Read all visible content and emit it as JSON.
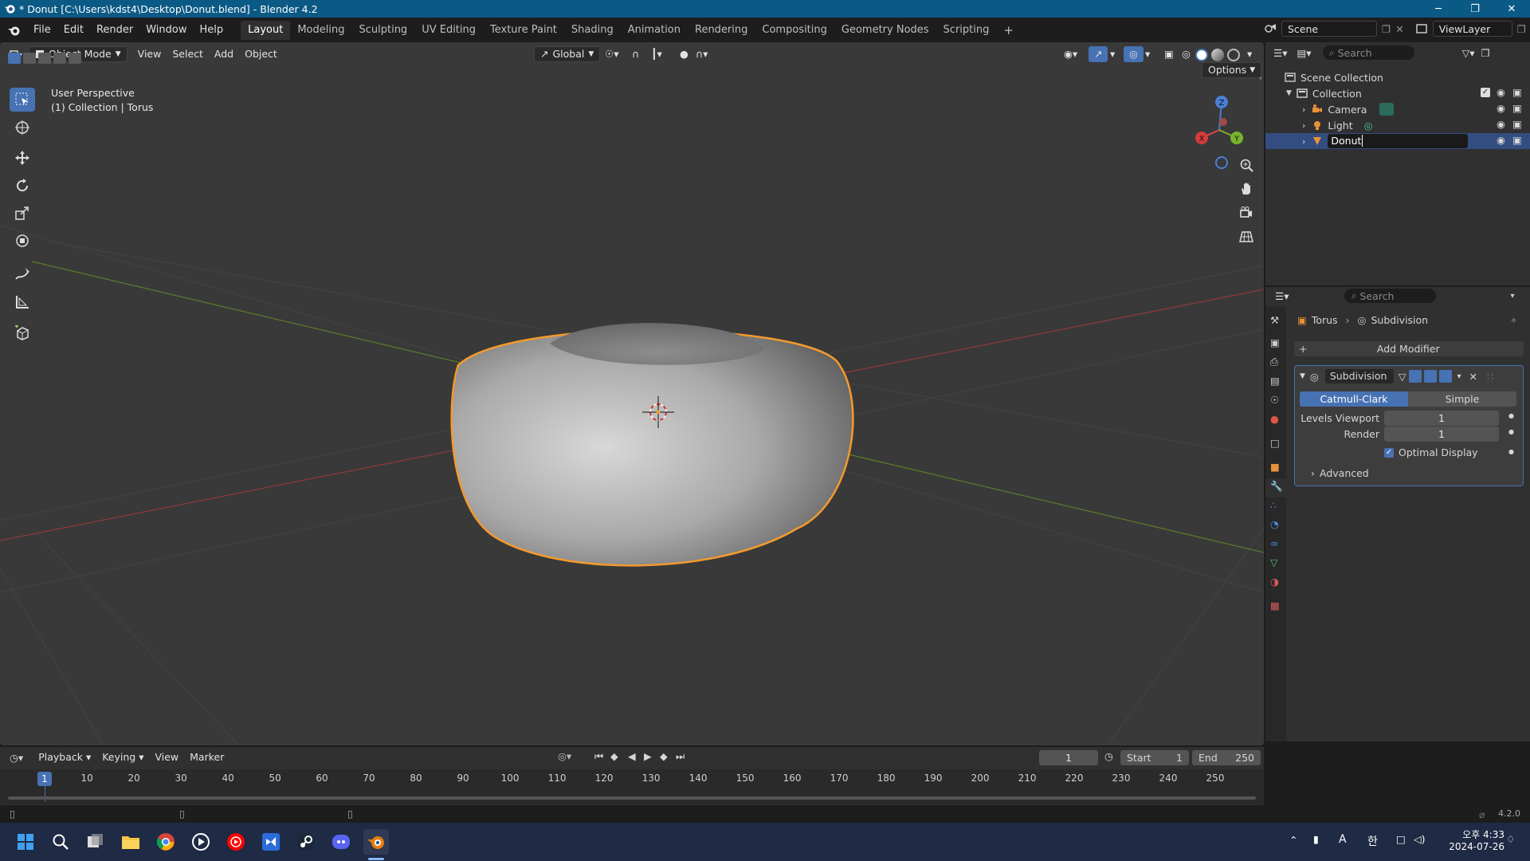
{
  "window": {
    "title": "* Donut [C:\\Users\\kdst4\\Desktop\\Donut.blend] - Blender 4.2"
  },
  "menu": [
    "File",
    "Edit",
    "Render",
    "Window",
    "Help"
  ],
  "workspaces": [
    "Layout",
    "Modeling",
    "Sculpting",
    "UV Editing",
    "Texture Paint",
    "Shading",
    "Animation",
    "Rendering",
    "Compositing",
    "Geometry Nodes",
    "Scripting"
  ],
  "active_workspace": "Layout",
  "scene": {
    "name": "Scene",
    "view_layer": "ViewLayer"
  },
  "viewport": {
    "mode": "Object Mode",
    "menus": [
      "View",
      "Select",
      "Add",
      "Object"
    ],
    "transform_orientation": "Global",
    "options_label": "Options",
    "perspective_label": "User Perspective",
    "context_label": "(1) Collection | Torus",
    "gizmo_axes": {
      "x": "X",
      "y": "Y",
      "z": "Z"
    }
  },
  "outliner": {
    "search_placeholder": "Search",
    "root": "Scene Collection",
    "collection": "Collection",
    "items": [
      "Camera",
      "Light"
    ],
    "editing_item": "Donut"
  },
  "properties": {
    "search_placeholder": "Search",
    "breadcrumb_object": "Torus",
    "breadcrumb_modifier": "Subdivision",
    "add_modifier": "Add Modifier",
    "modifier_name": "Subdivision",
    "mode_options": [
      "Catmull-Clark",
      "Simple"
    ],
    "active_mode": "Catmull-Clark",
    "levels_viewport_label": "Levels Viewport",
    "levels_viewport": "1",
    "render_label": "Render",
    "render_levels": "1",
    "optimal_display_label": "Optimal Display",
    "optimal_display": true,
    "advanced_label": "Advanced"
  },
  "timeline": {
    "menus": [
      "Playback",
      "Keying",
      "View",
      "Marker"
    ],
    "current_frame": "1",
    "start_label": "Start",
    "start": "1",
    "end_label": "End",
    "end": "250",
    "ticks": [
      "10",
      "20",
      "30",
      "40",
      "50",
      "60",
      "70",
      "80",
      "90",
      "100",
      "110",
      "120",
      "130",
      "140",
      "150",
      "160",
      "170",
      "180",
      "190",
      "200",
      "210",
      "220",
      "230",
      "240",
      "250"
    ],
    "playhead": "1"
  },
  "status": {
    "version": "4.2.0"
  },
  "taskbar": {
    "time": "오후 4:33",
    "date": "2024-07-26",
    "ime": "A",
    "ime2": "한"
  },
  "colors": {
    "selection": "#f49a2d",
    "accent": "#4772b3",
    "titlebar": "#0b5a85"
  }
}
